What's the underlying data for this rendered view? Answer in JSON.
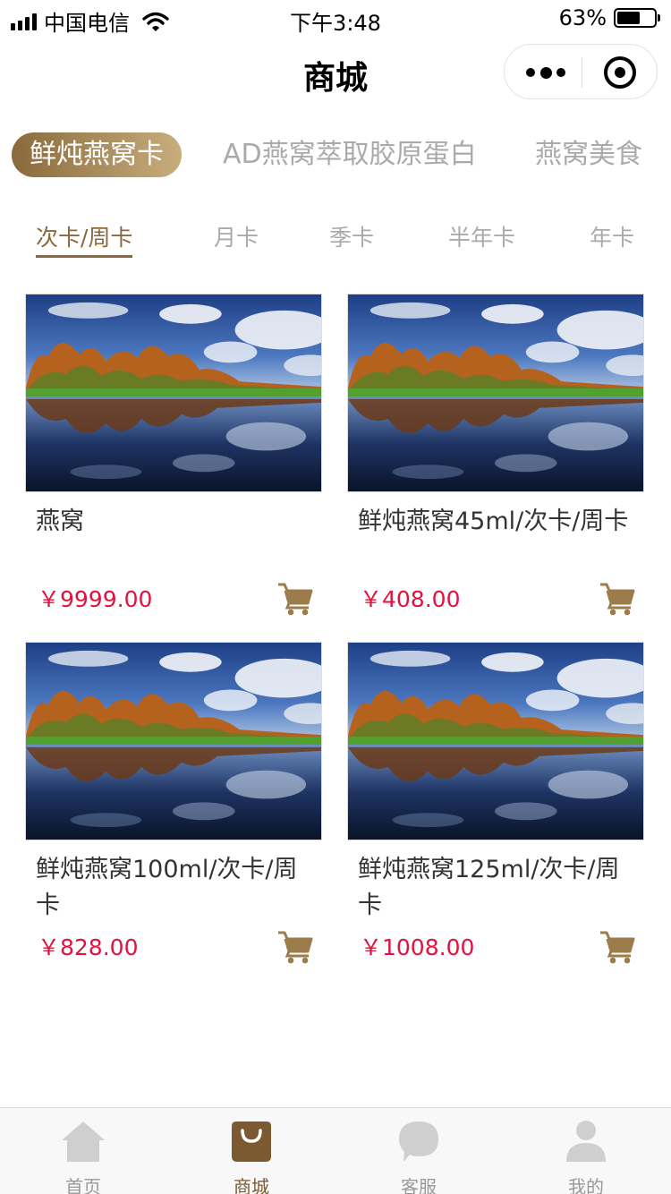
{
  "status_bar": {
    "carrier": "中国电信",
    "time": "下午3:48",
    "battery_text": "63%",
    "battery_level": 0.63
  },
  "nav": {
    "title": "商城"
  },
  "category_tabs": [
    {
      "label": "鲜炖燕窝卡",
      "active": true
    },
    {
      "label": "AD燕窝萃取胶原蛋白",
      "active": false
    },
    {
      "label": "燕窝美食",
      "active": false
    }
  ],
  "sub_tabs": [
    {
      "label": "次卡/周卡",
      "active": true
    },
    {
      "label": "月卡",
      "active": false
    },
    {
      "label": "季卡",
      "active": false
    },
    {
      "label": "半年卡",
      "active": false
    },
    {
      "label": "年卡",
      "active": false
    }
  ],
  "products": [
    {
      "name": "燕窝",
      "price": "￥9999.00"
    },
    {
      "name": "鲜炖燕窝45ml/次卡/周卡",
      "price": "￥408.00"
    },
    {
      "name": "鲜炖燕窝100ml/次卡/周卡",
      "price": "￥828.00"
    },
    {
      "name": "鲜炖燕窝125ml/次卡/周卡",
      "price": "￥1008.00"
    }
  ],
  "tabbar": [
    {
      "label": "首页",
      "icon": "home-icon",
      "active": false
    },
    {
      "label": "商城",
      "icon": "shopping-bag-icon",
      "active": true
    },
    {
      "label": "客服",
      "icon": "chat-bubble-icon",
      "active": false
    },
    {
      "label": "我的",
      "icon": "user-icon",
      "active": false
    }
  ],
  "colors": {
    "brand": "#8a6a3c",
    "price": "#e0133f",
    "inactive": "#aaaaaa"
  }
}
